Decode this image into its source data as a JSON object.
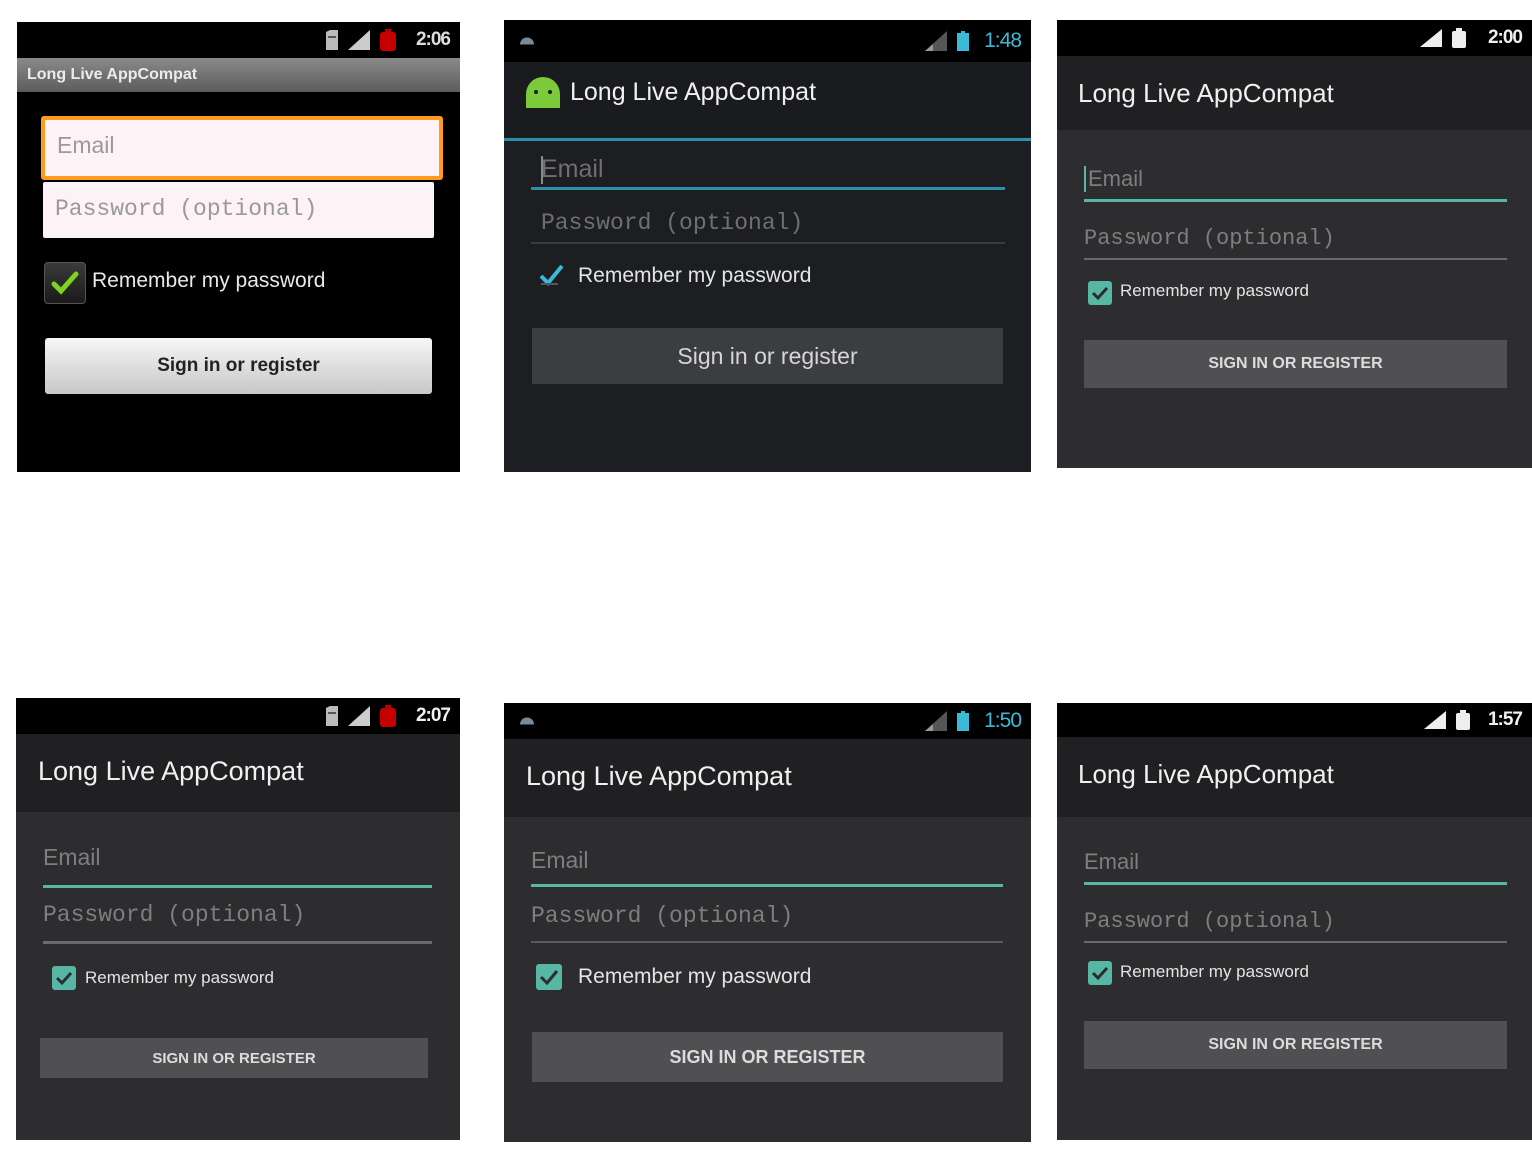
{
  "colors": {
    "page_background": "#ffffff",
    "gingerbread_background": "#000000",
    "gingerbread_focus_border": "#ff9a1f",
    "holo_background": "#2d2d2f",
    "holo_blue_accent": "#2e8da8",
    "material_teal_accent": "#57b7a4",
    "button_background": "#505052"
  },
  "screens": [
    {
      "theme": "Gingerbread",
      "status_time": "2:06",
      "app_title": "Long Live AppCompat",
      "email_placeholder": "Email",
      "password_placeholder": "Password (optional)",
      "remember_label": "Remember my password",
      "remember_checked": true,
      "button_label": "Sign in or register",
      "icons": [
        "sd-card-icon",
        "signal-icon",
        "battery-icon",
        "check-icon"
      ]
    },
    {
      "theme": "Holo Dark",
      "status_time": "1:48",
      "app_title": "Long Live AppCompat",
      "email_placeholder": "Email",
      "password_placeholder": "Password (optional)",
      "remember_label": "Remember my password",
      "remember_checked": true,
      "button_label": "Sign in or register",
      "icons": [
        "notification-icon",
        "signal-icon",
        "battery-icon",
        "android-logo-icon",
        "check-icon"
      ]
    },
    {
      "theme": "Material Dark",
      "status_time": "2:00",
      "app_title": "Long Live AppCompat",
      "email_placeholder": "Email",
      "password_placeholder": "Password (optional)",
      "remember_label": "Remember my password",
      "remember_checked": true,
      "button_label": "SIGN IN OR REGISTER",
      "icons": [
        "signal-icon",
        "battery-icon",
        "check-icon"
      ]
    },
    {
      "theme": "Material Dark (Gingerbread device)",
      "status_time": "2:07",
      "app_title": "Long Live AppCompat",
      "email_placeholder": "Email",
      "password_placeholder": "Password (optional)",
      "remember_label": "Remember my password",
      "remember_checked": true,
      "button_label": "SIGN IN OR REGISTER",
      "icons": [
        "sd-card-icon",
        "signal-icon",
        "battery-icon",
        "check-icon"
      ]
    },
    {
      "theme": "Material Dark (Holo device)",
      "status_time": "1:50",
      "app_title": "Long Live AppCompat",
      "email_placeholder": "Email",
      "password_placeholder": "Password (optional)",
      "remember_label": "Remember my password",
      "remember_checked": true,
      "button_label": "SIGN IN OR REGISTER",
      "icons": [
        "notification-icon",
        "signal-icon",
        "battery-icon",
        "check-icon"
      ]
    },
    {
      "theme": "Material Dark (Lollipop device)",
      "status_time": "1:57",
      "app_title": "Long Live AppCompat",
      "email_placeholder": "Email",
      "password_placeholder": "Password (optional)",
      "remember_label": "Remember my password",
      "remember_checked": true,
      "button_label": "SIGN IN OR REGISTER",
      "icons": [
        "signal-icon",
        "battery-icon",
        "check-icon"
      ]
    }
  ]
}
